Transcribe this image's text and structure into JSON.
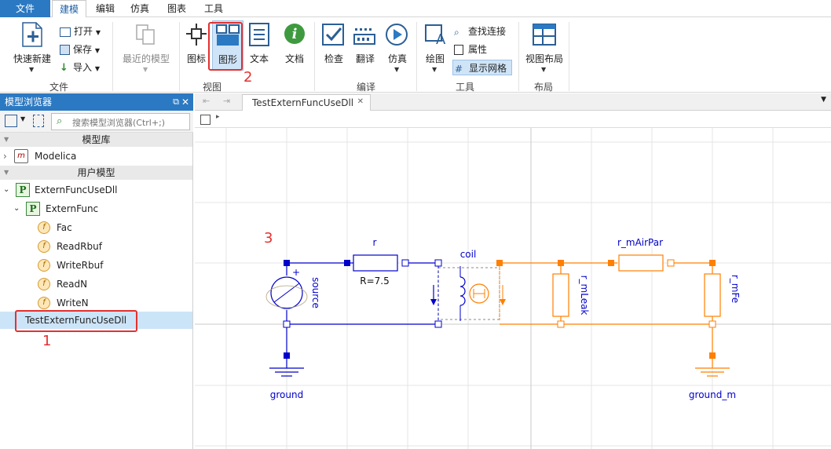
{
  "menubar": {
    "file": "文件",
    "items": [
      "建模",
      "编辑",
      "仿真",
      "图表",
      "工具"
    ]
  },
  "ribbon": {
    "file_group": {
      "label": "文件",
      "quick_new": "快速新建",
      "open": "打开",
      "save": "保存",
      "import": "导入"
    },
    "recent_models": "最近的模型",
    "view_group": {
      "label": "视图",
      "icon": "图标",
      "diagram": "图形",
      "text": "文本",
      "doc": "文档"
    },
    "compile_group": {
      "label": "编译",
      "check": "检查",
      "translate": "翻译",
      "simulate": "仿真"
    },
    "tools_group": {
      "label": "工具",
      "draw": "绘图",
      "find_connection": "查找连接",
      "properties": "属性",
      "show_grid": "显示网格"
    },
    "layout_group": {
      "label": "布局",
      "view_layout": "视图布局"
    }
  },
  "model_browser": {
    "title": "模型浏览器",
    "search_placeholder": "搜索模型浏览器(Ctrl+;)",
    "section_library": "模型库",
    "library_items": [
      "Modelica"
    ],
    "section_user": "用户模型",
    "user_tree": {
      "root": "ExternFuncUseDll",
      "package": "ExternFunc",
      "functions": [
        "Fac",
        "ReadRbuf",
        "WriteRbuf",
        "ReadN",
        "WriteN"
      ],
      "selected_model": "TestExternFuncUseDll"
    }
  },
  "editor": {
    "tab_title": "TestExternFuncUseDll",
    "diagram": {
      "r_label": "r",
      "r_value": "R=7.5",
      "coil_label": "coil",
      "source_label": "source",
      "ground_label": "ground",
      "r_mAirPar_label": "r_mAirPar",
      "r_mLeak_label": "r_mLeak",
      "r_mFe_label": "r_mFe",
      "ground_m_label": "ground_m",
      "plus_sign": "+"
    }
  },
  "annotations": {
    "one": "1",
    "two": "2",
    "three": "3"
  },
  "colors": {
    "accent": "#2b79c2",
    "electric": "#0000cc",
    "magnetic": "#ff7f00",
    "annotation": "#e53030"
  }
}
